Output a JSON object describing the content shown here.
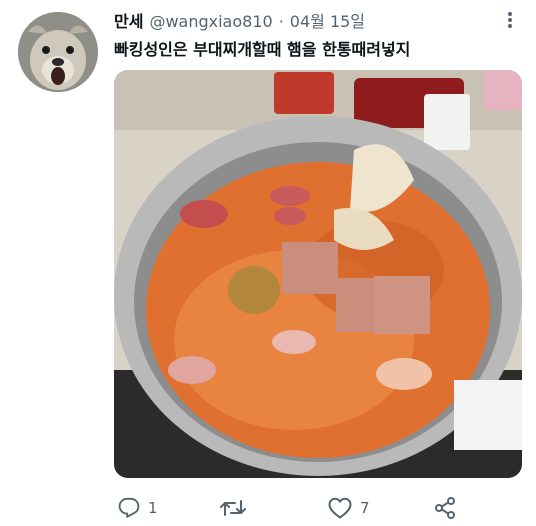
{
  "tweet": {
    "display_name": "만세",
    "handle": "@wangxiao810",
    "separator": "·",
    "date": "04월 15일",
    "text": "빠킹성인은 부대찌개할때 햄을 한통때려넣지"
  },
  "actions": {
    "reply_count": "1",
    "retweet_count": "",
    "like_count": "7"
  },
  "colors": {
    "text_primary": "#0f1419",
    "text_secondary": "#536471"
  },
  "icons": [
    "avatar-dog",
    "more-icon",
    "reply-icon",
    "retweet-icon",
    "like-icon",
    "share-icon"
  ]
}
